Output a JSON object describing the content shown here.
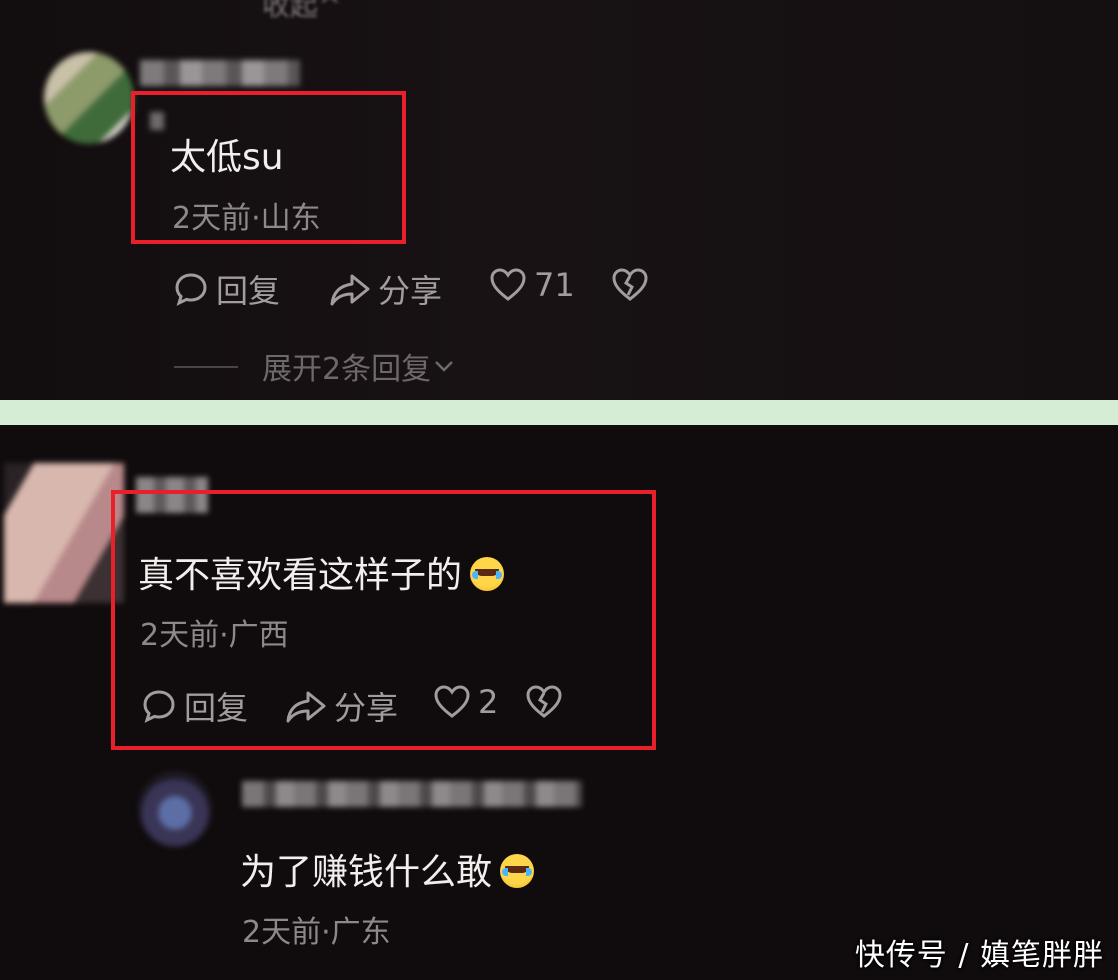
{
  "top_cut_text": "收起^",
  "comment1": {
    "text": "太低su",
    "meta": "2天前·山东",
    "reply": "回复",
    "share": "分享",
    "likes": "71",
    "expand": "展开2条回复"
  },
  "comment2": {
    "text": "真不喜欢看这样子的",
    "meta": "2天前·广西",
    "reply": "回复",
    "share": "分享",
    "likes": "2"
  },
  "reply1": {
    "text": "为了赚钱什么敢",
    "meta": "2天前·广东"
  },
  "watermark": "快传号 / 嫃笔胖胖",
  "colors": {
    "highlight_box": "#e9202a",
    "divider": "#d5ecd5",
    "background": "#100b0c"
  },
  "icons": [
    "comment-bubble-icon",
    "share-arrow-icon",
    "heart-icon",
    "broken-heart-icon",
    "crying-laughing-emoji"
  ]
}
